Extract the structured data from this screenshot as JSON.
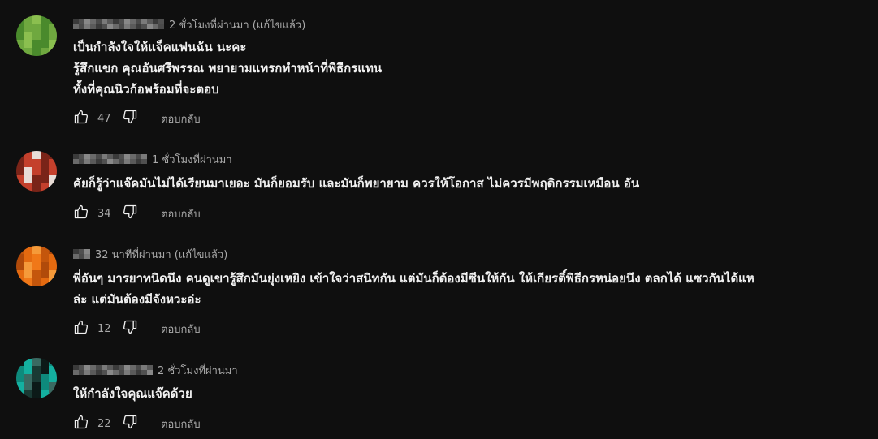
{
  "comments": [
    {
      "time": "2 ชั่วโมงที่ผ่านมา (แก้ไขแล้ว)",
      "lines": [
        "เป็นกำลังใจให้แจ็คแฟนฉัน นะคะ",
        "รู้สึกแขก คุณอันศรีพรรณ พยายามแทรกทำหน้าที่พิธีกรแทน",
        "ทั้งที่คุณนิวก้อพร้อมที่จะตอบ"
      ],
      "likes": "47",
      "reply_label": "ตอบกลับ",
      "avatar_colors": [
        "#4a8a2c",
        "#6fa83f",
        "#8bbf4f",
        "#6fa83f",
        "#4a8a2c"
      ]
    },
    {
      "time": "1 ชั่วโมงที่ผ่านมา",
      "lines": [
        "คัยก็รู้ว่าแจ๊คมันไม่ได้เรียนมาเยอะ มันก็ยอมรับ และมันก็พยายาม ควรให้โอกาส ไม่ควรมีพฤติกรรมเหมือน อัน"
      ],
      "likes": "34",
      "reply_label": "ตอบกลับ",
      "avatar_colors": [
        "#7a2418",
        "#c4402c",
        "#e8dcd6",
        "#c4402c",
        "#7a2418"
      ]
    },
    {
      "time": "32 นาทีที่ผ่านมา (แก้ไขแล้ว)",
      "lines": [
        "พี่อันๆ มารยาทนิดนึง คนดูเขารู้สึกมันยุ่งเหยิง เข้าใจว่าสนิทกัน แต่มันก็ต้องมีซีนให้กัน ให้เกียรติ์พิธีกรหน่อยนึง ตลกได้ แซวกันได้แห",
        "ล่ะ แต่มันต้องมีจังหวะอ่ะ"
      ],
      "likes": "12",
      "reply_label": "ตอบกลับ",
      "avatar_colors": [
        "#c4560c",
        "#f07818",
        "#f59a3a",
        "#e46a10",
        "#b04a0a"
      ]
    },
    {
      "time": "2 ชั่วโมงที่ผ่านมา",
      "lines": [
        "ให้กำลังใจคุณแจ๊คด้วย"
      ],
      "likes": "22",
      "reply_label": "ตอบกลับ",
      "avatar_colors": [
        "#0c1a18",
        "#1a3a34",
        "#3a6a62",
        "#14b0a0",
        "#0e8a7c"
      ]
    }
  ],
  "icons": {
    "like": "thumbs-up-outline",
    "dislike": "thumbs-down-outline"
  }
}
